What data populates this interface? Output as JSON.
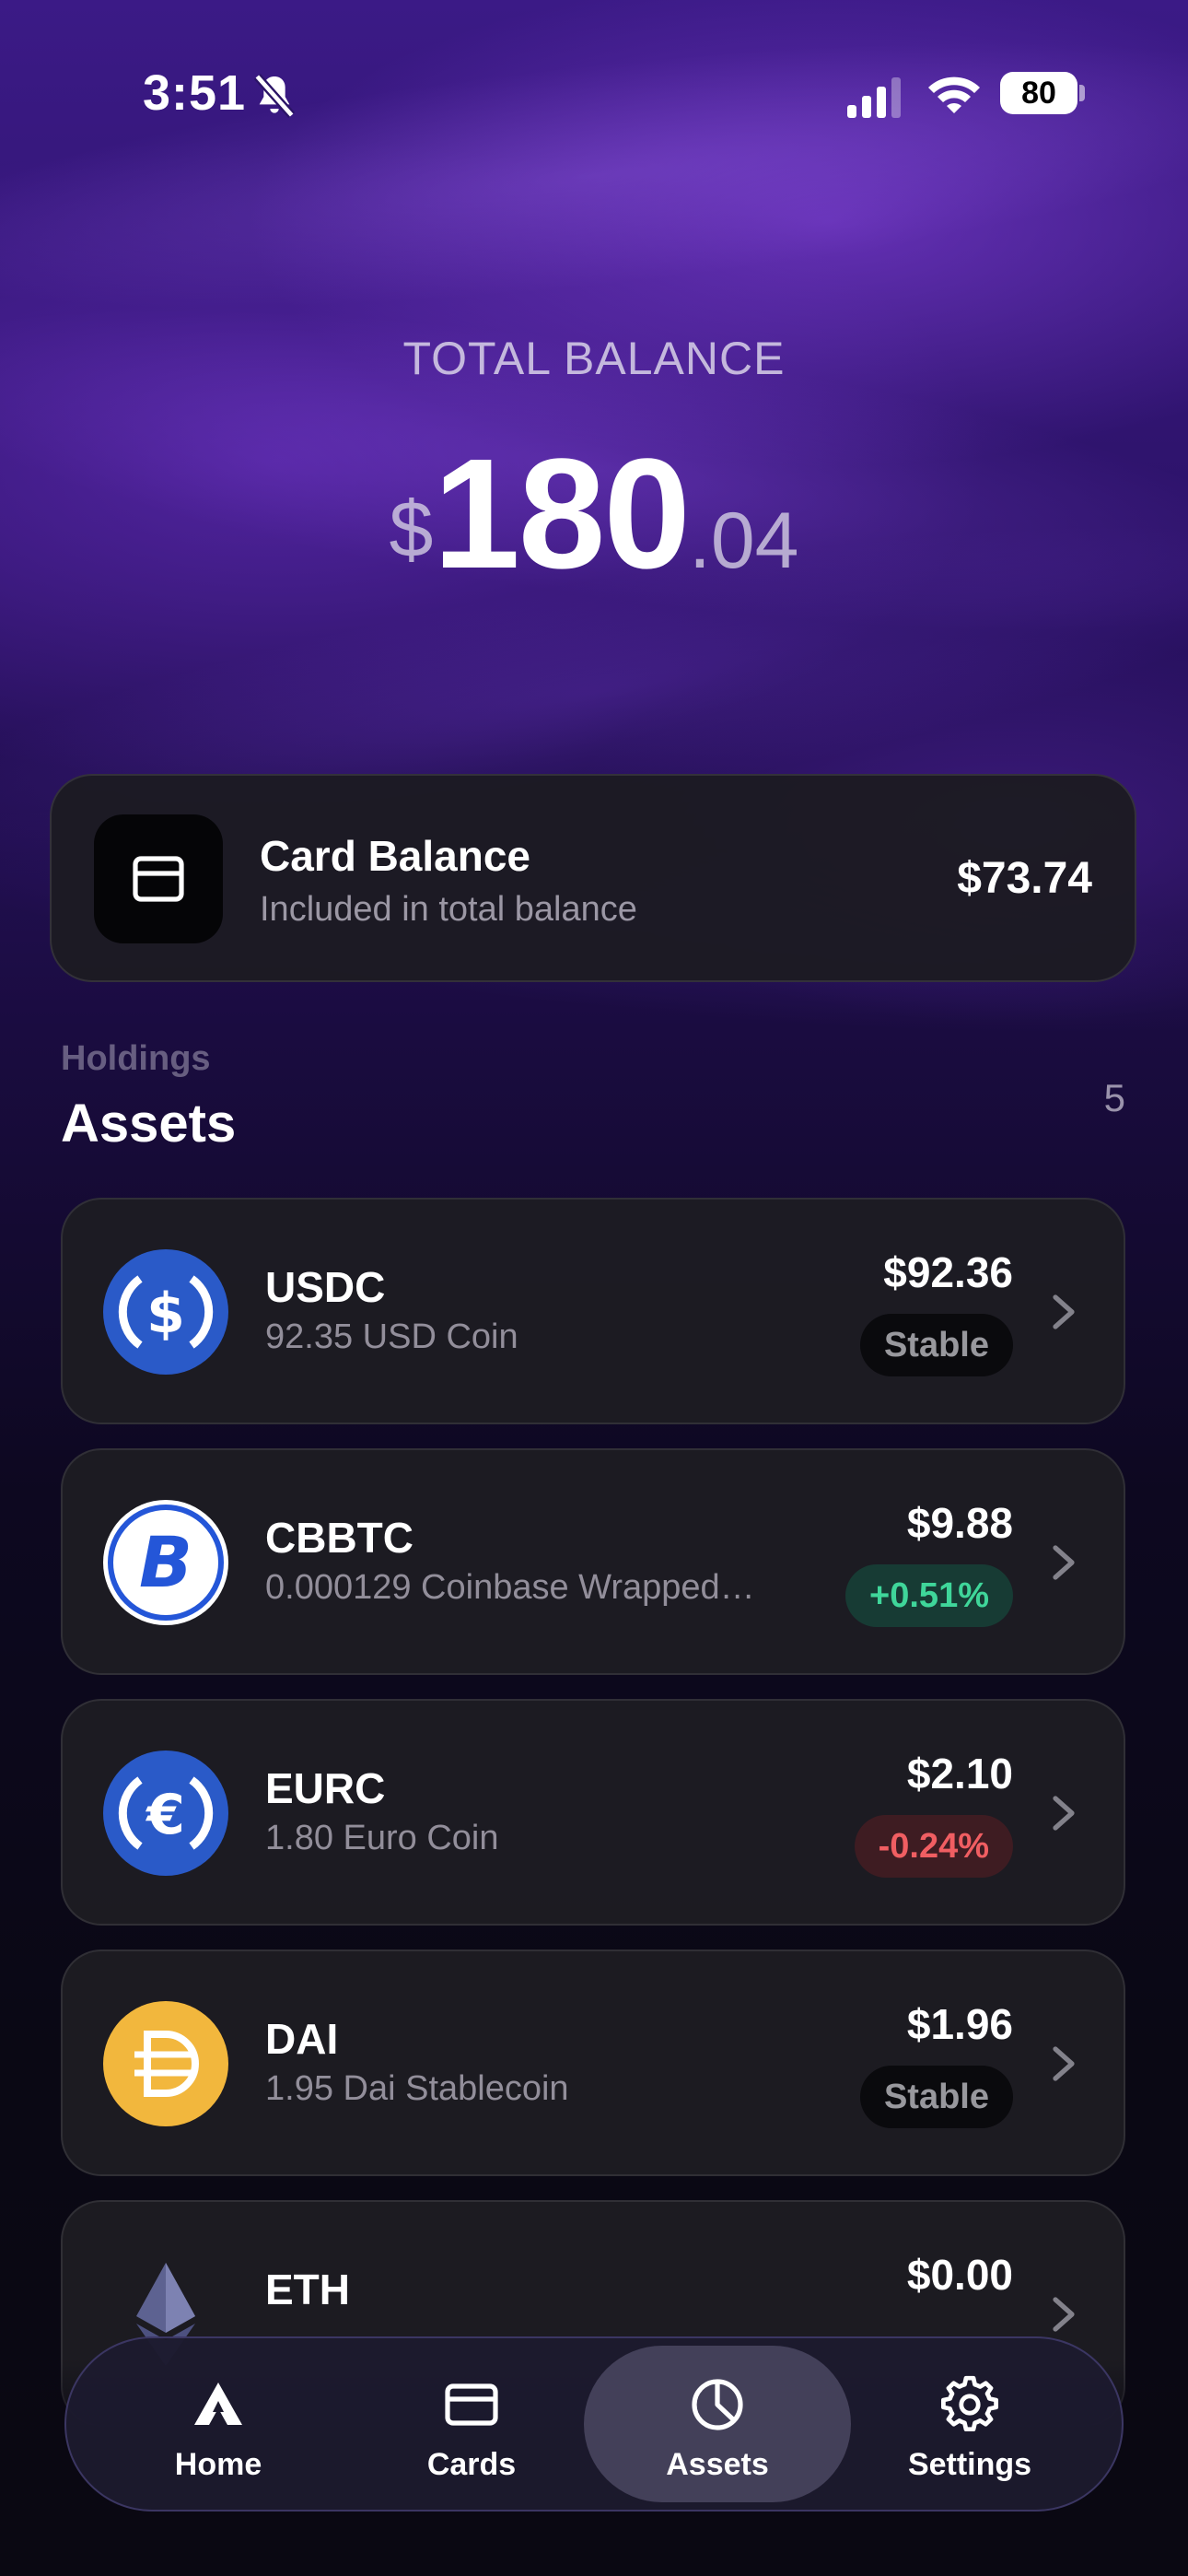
{
  "status_bar": {
    "time": "3:51",
    "battery": "80"
  },
  "balance": {
    "label": "TOTAL BALANCE",
    "currency": "$",
    "whole": "180",
    "fraction": ".04"
  },
  "card_balance": {
    "title": "Card Balance",
    "subtitle": "Included in total balance",
    "amount": "$73.74"
  },
  "holdings": {
    "label": "Holdings",
    "title": "Assets",
    "count": "5"
  },
  "assets": [
    {
      "symbol": "USDC",
      "detail": "92.35 USD Coin",
      "value": "$92.36",
      "badge": "Stable",
      "icon": "usdc-icon"
    },
    {
      "symbol": "CBBTC",
      "detail": "0.000129 Coinbase Wrapped…",
      "value": "$9.88",
      "badge": "+0.51%",
      "icon": "bitcoin-icon"
    },
    {
      "symbol": "EURC",
      "detail": "1.80 Euro Coin",
      "value": "$2.10",
      "badge": "-0.24%",
      "icon": "euro-coin-icon"
    },
    {
      "symbol": "DAI",
      "detail": "1.95 Dai Stablecoin",
      "value": "$1.96",
      "badge": "Stable",
      "icon": "dai-icon"
    },
    {
      "symbol": "ETH",
      "detail": "",
      "value": "$0.00",
      "badge": "",
      "icon": "ethereum-icon"
    }
  ],
  "nav": {
    "tabs": [
      {
        "label": "Home",
        "icon": "home-logo-icon"
      },
      {
        "label": "Cards",
        "icon": "card-icon"
      },
      {
        "label": "Assets",
        "icon": "pie-chart-icon"
      },
      {
        "label": "Settings",
        "icon": "gear-icon"
      }
    ],
    "active": "Assets"
  },
  "colors": {
    "accent_purple": "#3b1a86",
    "positive": "#3fd69a",
    "negative": "#f05e62",
    "usdc_blue": "#2a5ac8",
    "dai_yellow": "#f2b73d"
  }
}
